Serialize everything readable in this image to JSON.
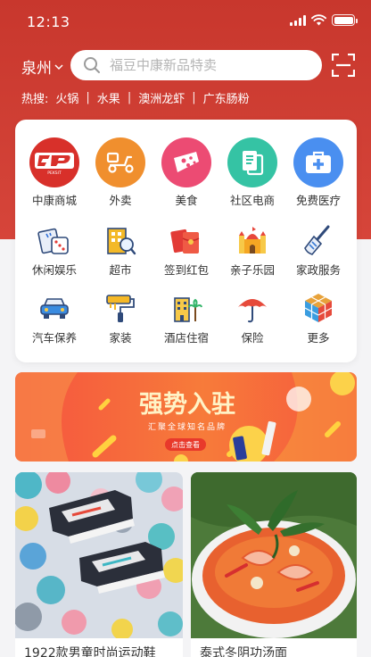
{
  "status": {
    "time": "12:13"
  },
  "header": {
    "city": "泉州",
    "search_placeholder": "福豆中康新品特卖",
    "hot_label": "热搜:",
    "hot_items": [
      "火锅",
      "水果",
      "澳洲龙虾",
      "广东肠粉"
    ]
  },
  "icon_brand": "PEKSIT",
  "menu": [
    {
      "label": "中康商城",
      "icon": "brand-logo-icon",
      "color": "#d8302a"
    },
    {
      "label": "外卖",
      "icon": "scooter-icon",
      "color": "#f08f2e"
    },
    {
      "label": "美食",
      "icon": "cake-icon",
      "color": "#ec4b73"
    },
    {
      "label": "社区电商",
      "icon": "document-icon",
      "color": "#35c3a4"
    },
    {
      "label": "免费医疗",
      "icon": "medical-kit-icon",
      "color": "#4a8ff0"
    },
    {
      "label": "休闲娱乐",
      "icon": "dice-icon",
      "color": "#2f6fd6"
    },
    {
      "label": "超市",
      "icon": "store-icon",
      "color": "#f3b928"
    },
    {
      "label": "签到红包",
      "icon": "red-envelope-icon",
      "color": "#e23b36"
    },
    {
      "label": "亲子乐园",
      "icon": "castle-icon",
      "color": "#f5a623"
    },
    {
      "label": "家政服务",
      "icon": "broom-icon",
      "color": "#3a7bd5"
    },
    {
      "label": "汽车保养",
      "icon": "car-icon",
      "color": "#2d6fd4"
    },
    {
      "label": "家装",
      "icon": "paint-roller-icon",
      "color": "#f5b826"
    },
    {
      "label": "酒店住宿",
      "icon": "hotel-icon",
      "color": "#e8a33a"
    },
    {
      "label": "保险",
      "icon": "umbrella-icon",
      "color": "#e64a3b"
    },
    {
      "label": "更多",
      "icon": "cube-icon",
      "color": "#e8a23a"
    }
  ],
  "banner": {
    "title": "强势入驻",
    "subtitle": "汇聚全球知名品牌",
    "button_label": "点击查看"
  },
  "products": [
    {
      "title": "1922款男童时尚运动鞋"
    },
    {
      "title": "泰式冬阴功汤面"
    }
  ]
}
